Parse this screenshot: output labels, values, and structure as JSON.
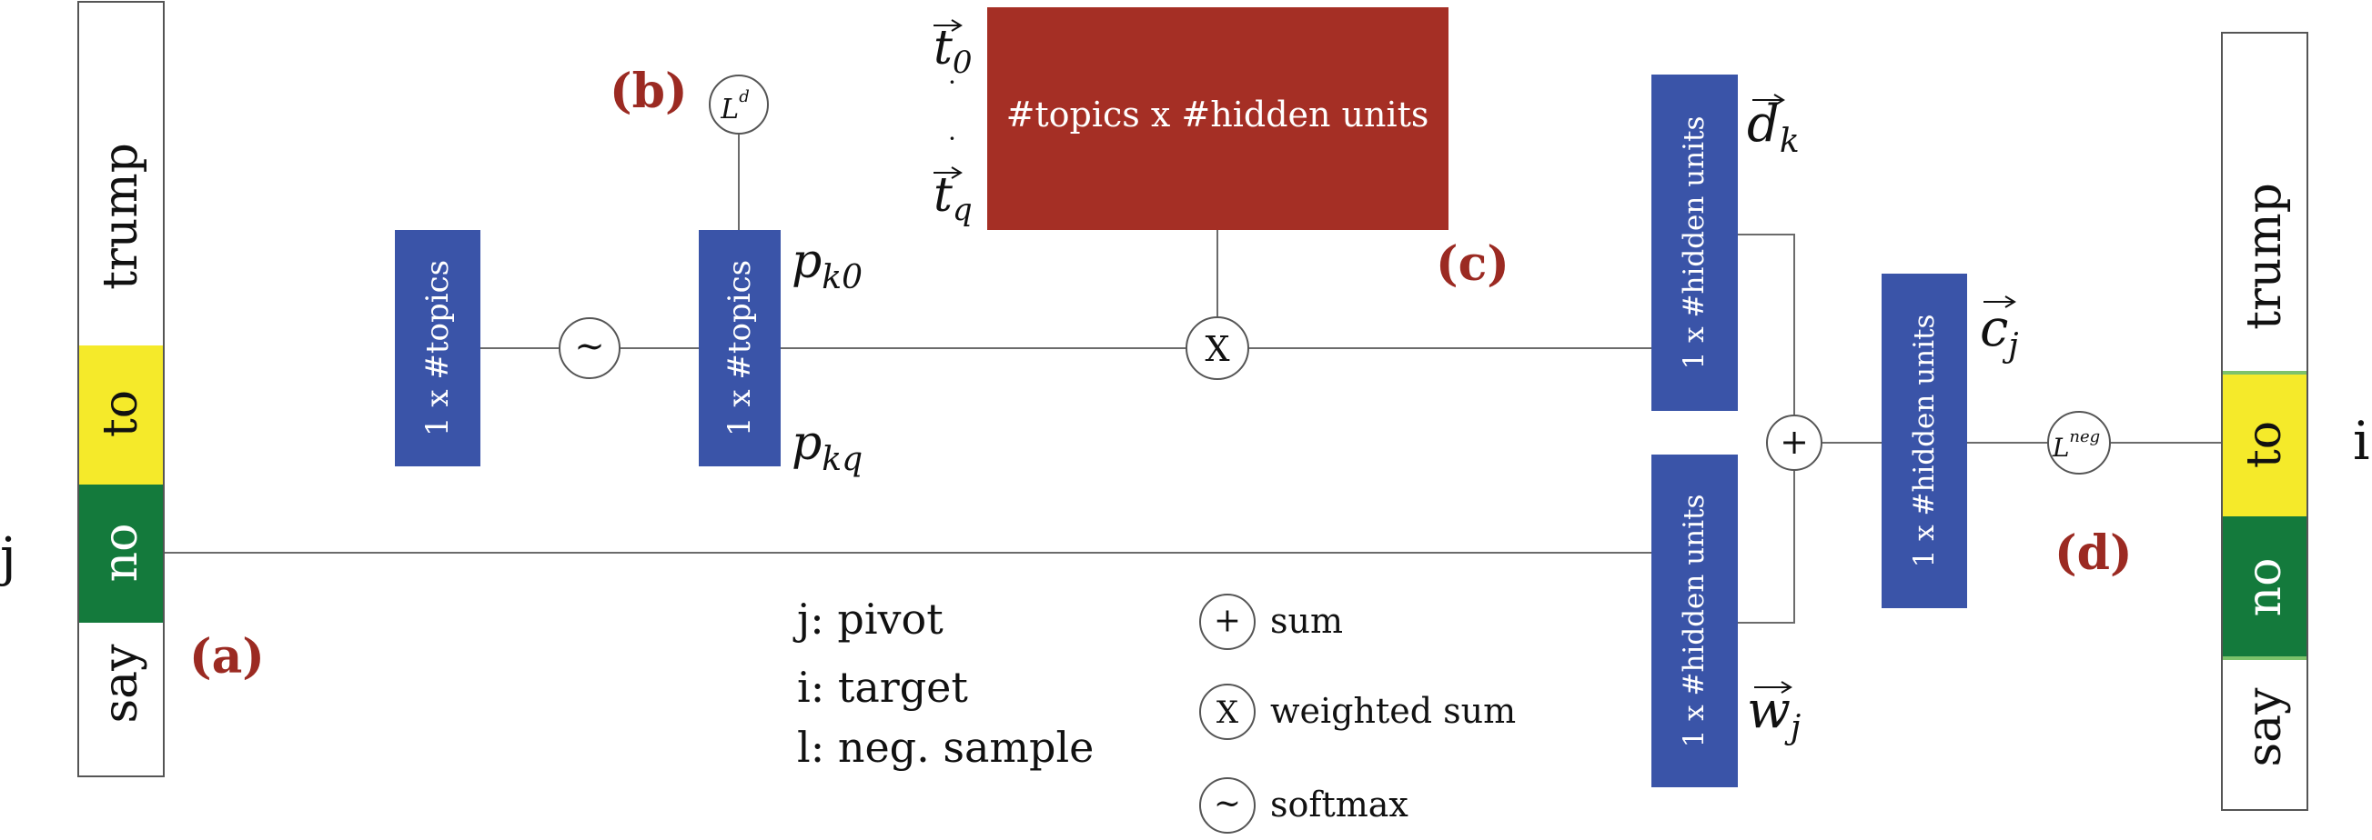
{
  "colors": {
    "blue": "#3a54a8",
    "red": "#a52f25",
    "yellow": "#f5ea2a",
    "green": "#147a3c",
    "label_red": "#9b2a22"
  },
  "left_sentence": {
    "words": [
      "trump",
      "to",
      "no",
      "say"
    ]
  },
  "right_sentence": {
    "words": [
      "trump",
      "to",
      "no",
      "say"
    ]
  },
  "boxes": {
    "topics_vector": "1 x #topics",
    "topics_softmax": "1 x #topics",
    "topic_matrix": "#topics x #hidden units",
    "doc_vector": "1 x #hidden units",
    "word_vector": "1 x #hidden units",
    "context_vector": "1 x #hidden units"
  },
  "operators": {
    "softmax": "~",
    "weighted_sum": "X",
    "sum": "+",
    "loss_d": "L",
    "loss_d_sup": "d",
    "loss_neg": "L",
    "loss_neg_sup": "neg"
  },
  "math": {
    "p_k0": "p",
    "p_k0_sub": "k0",
    "p_kq": "p",
    "p_kq_sub": "kq",
    "t0": "t",
    "t0_sub": "0",
    "tq": "t",
    "tq_sub": "q",
    "dk": "d",
    "dk_sub": "k",
    "cj": "c",
    "cj_sub": "j",
    "wj": "w",
    "wj_sub": "j",
    "dot": "·"
  },
  "labels": {
    "a": "(a)",
    "b": "(b)",
    "c": "(c)",
    "d": "(d)",
    "j": "j",
    "i": "i"
  },
  "legend": {
    "pivot": "j: pivot",
    "target": "i: target",
    "neg_sample": "l: neg. sample",
    "sum_symbol": "+",
    "sum": "sum",
    "weighted_sum_symbol": "X",
    "weighted_sum": "weighted sum",
    "softmax_symbol": "~",
    "softmax": "softmax"
  }
}
